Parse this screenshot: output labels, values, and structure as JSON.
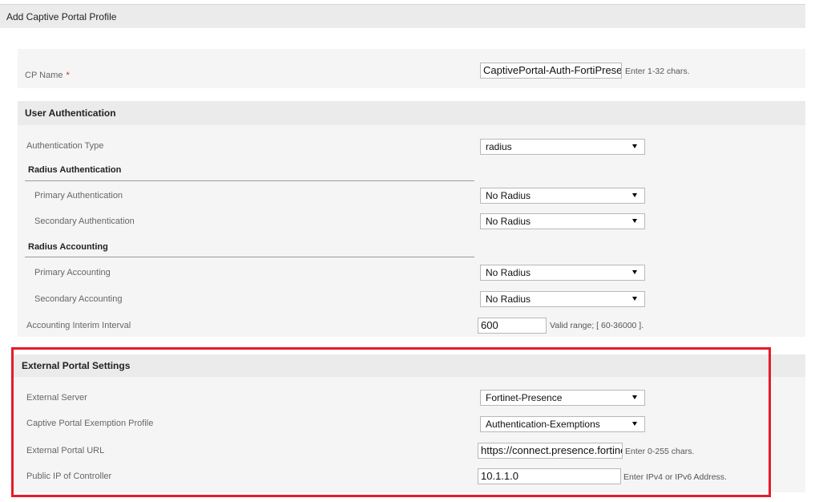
{
  "page_title": "Add Captive Portal Profile",
  "cp_name": {
    "label": "CP Name",
    "required_mark": "*",
    "value": "CaptivePortal-Auth-FortiPresence",
    "hint": "Enter 1-32 chars."
  },
  "user_auth": {
    "title": "User Authentication",
    "auth_type": {
      "label": "Authentication Type",
      "value": "radius"
    },
    "radius_auth": {
      "title": "Radius Authentication",
      "primary": {
        "label": "Primary Authentication",
        "value": "No Radius"
      },
      "secondary": {
        "label": "Secondary Authentication",
        "value": "No Radius"
      }
    },
    "radius_acct": {
      "title": "Radius Accounting",
      "primary": {
        "label": "Primary Accounting",
        "value": "No Radius"
      },
      "secondary": {
        "label": "Secondary Accounting",
        "value": "No Radius"
      }
    },
    "interim": {
      "label": "Accounting Interim Interval",
      "value": "600",
      "hint": "Valid range; [ 60-36000 ]."
    }
  },
  "external_portal": {
    "title": "External Portal Settings",
    "server": {
      "label": "External Server",
      "value": "Fortinet-Presence"
    },
    "exemption": {
      "label": "Captive Portal Exemption Profile",
      "value": "Authentication-Exemptions"
    },
    "url": {
      "label": "External Portal URL",
      "value": "https://connect.presence.fortinet.com",
      "hint": "Enter 0-255 chars."
    },
    "public_ip": {
      "label": "Public IP of Controller",
      "value": "10.1.1.0",
      "hint": "Enter IPv4 or IPv6 Address."
    }
  },
  "colors": {
    "highlight": "#e41c2a",
    "panel_bg": "#f5f5f5",
    "header_bg": "#ebebeb",
    "required": "#e02020"
  }
}
